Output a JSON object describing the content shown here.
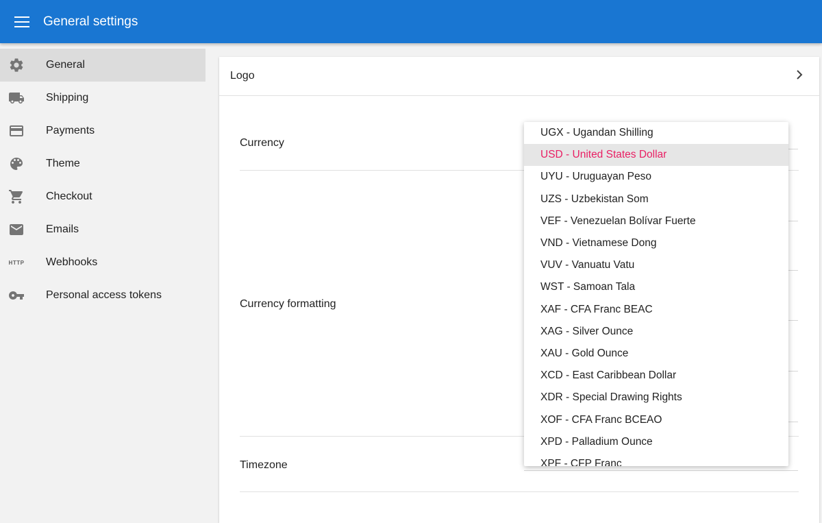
{
  "appbar": {
    "title": "General settings"
  },
  "sidebar": {
    "items": [
      {
        "label": "General",
        "icon": "gear-icon"
      },
      {
        "label": "Shipping",
        "icon": "truck-icon"
      },
      {
        "label": "Payments",
        "icon": "credit-card-icon"
      },
      {
        "label": "Theme",
        "icon": "palette-icon"
      },
      {
        "label": "Checkout",
        "icon": "cart-icon"
      },
      {
        "label": "Emails",
        "icon": "mail-icon"
      },
      {
        "label": "Webhooks",
        "icon": "http-icon",
        "icon_text": "HTTP"
      },
      {
        "label": "Personal access tokens",
        "icon": "key-icon"
      }
    ]
  },
  "main": {
    "logo": {
      "label": "Logo"
    },
    "fields": {
      "currency": "Currency",
      "currency_formatting": "Currency formatting",
      "timezone": "Timezone"
    }
  },
  "currency_dropdown": {
    "options": [
      "UGX - Ugandan Shilling",
      "USD - United States Dollar",
      "UYU - Uruguayan Peso",
      "UZS - Uzbekistan Som",
      "VEF - Venezuelan Bolívar Fuerte",
      "VND - Vietnamese Dong",
      "VUV - Vanuatu Vatu",
      "WST - Samoan Tala",
      "XAF - CFA Franc BEAC",
      "XAG - Silver Ounce",
      "XAU - Gold Ounce",
      "XCD - East Caribbean Dollar",
      "XDR - Special Drawing Rights",
      "XOF - CFA Franc BCEAO",
      "XPD - Palladium Ounce",
      "XPF - CFP Franc"
    ],
    "selected": "USD - United States Dollar"
  },
  "colors": {
    "appbar": "#1976d2",
    "selected_text": "#e91e63"
  }
}
